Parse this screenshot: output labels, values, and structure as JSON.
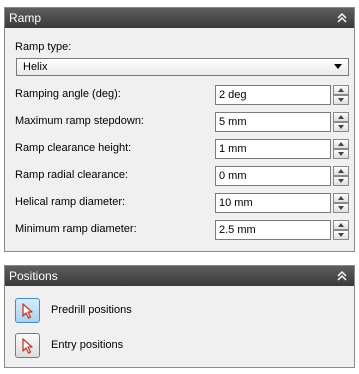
{
  "ramp_panel": {
    "title": "Ramp",
    "ramp_type": {
      "label": "Ramp type:",
      "selected": "Helix"
    },
    "fields": [
      {
        "label": "Ramping angle (deg):",
        "value": "2 deg"
      },
      {
        "label": "Maximum ramp stepdown:",
        "value": "5 mm"
      },
      {
        "label": "Ramp clearance height:",
        "value": "1 mm"
      },
      {
        "label": "Ramp radial clearance:",
        "value": "0 mm"
      },
      {
        "label": "Helical ramp diameter:",
        "value": "10 mm"
      },
      {
        "label": "Minimum ramp diameter:",
        "value": "2.5 mm"
      }
    ]
  },
  "positions_panel": {
    "title": "Positions",
    "items": [
      {
        "label": "Predrill positions",
        "active": true,
        "icon": "pointer-select-icon"
      },
      {
        "label": "Entry positions",
        "active": false,
        "icon": "pointer-select-icon"
      }
    ]
  },
  "colors": {
    "header_bg": "#4a4a4a",
    "panel_bg": "#f0f0f0",
    "active_button": "#a9d2f0",
    "pointer_icon": "#c0392b"
  }
}
